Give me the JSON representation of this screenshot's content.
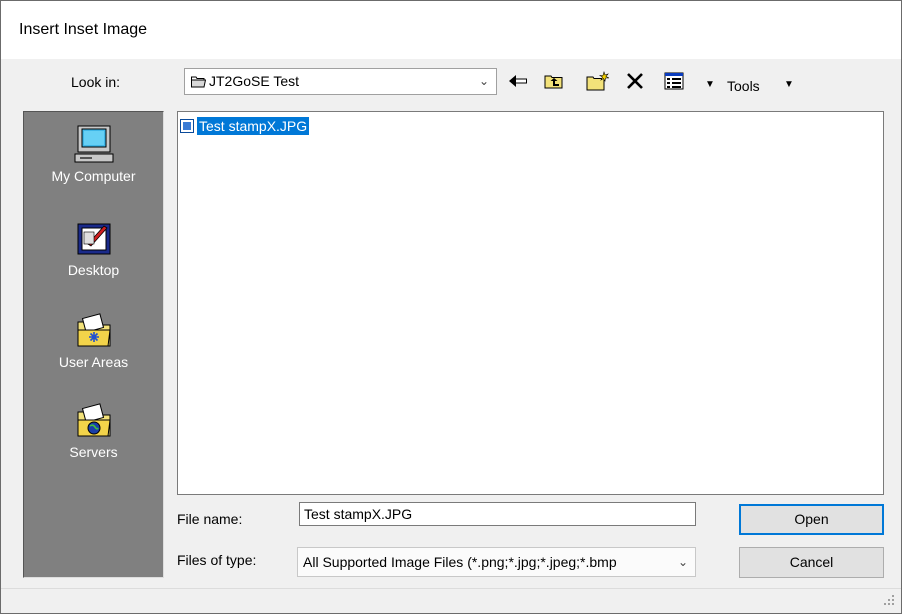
{
  "window": {
    "title": "Insert Inset Image"
  },
  "lookin": {
    "label": "Look in:",
    "value": "JT2GoSE Test"
  },
  "toolbar": {
    "icons": [
      "back-arrow-icon",
      "up-folder-icon",
      "new-folder-icon",
      "delete-icon",
      "view-menu-icon"
    ],
    "tools_label": "Tools"
  },
  "places": [
    {
      "label": "My Computer",
      "icon": "my-computer-icon"
    },
    {
      "label": "Desktop",
      "icon": "desktop-icon"
    },
    {
      "label": "User Areas",
      "icon": "user-areas-icon"
    },
    {
      "label": "Servers",
      "icon": "servers-icon"
    }
  ],
  "files": [
    {
      "name": "Test stampX.JPG",
      "selected": true
    }
  ],
  "filename": {
    "label": "File name:",
    "value": "Test stampX.JPG"
  },
  "filetype": {
    "label": "Files of type:",
    "value": "All Supported Image Files (*.png;*.jpg;*.jpeg;*.bmp"
  },
  "buttons": {
    "open": "Open",
    "cancel": "Cancel"
  },
  "colors": {
    "selection": "#0078d7",
    "places_bg": "#808080"
  }
}
